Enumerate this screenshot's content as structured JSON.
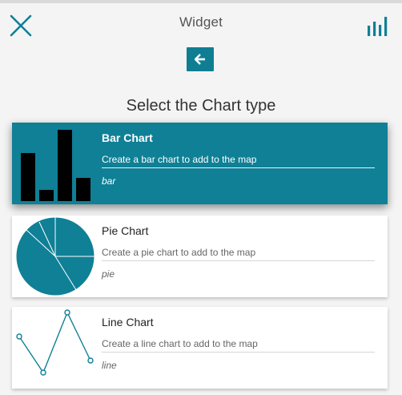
{
  "header": {
    "title": "Widget",
    "close_icon": "close-icon",
    "chart_icon": "bar-chart-icon"
  },
  "back_button": {
    "icon": "arrow-left-icon"
  },
  "section_title": "Select the Chart type",
  "chart_types": [
    {
      "name": "Bar Chart",
      "description": "Create a bar chart to add to the map",
      "tag": "bar",
      "selected": true
    },
    {
      "name": "Pie Chart",
      "description": "Create a pie chart to add to the map",
      "tag": "pie",
      "selected": false
    },
    {
      "name": "Line Chart",
      "description": "Create a line chart to add to the map",
      "tag": "line",
      "selected": false
    }
  ],
  "colors": {
    "accent": "#0f8096",
    "card_bg": "#ffffff",
    "panel_bg": "#f4f4f4"
  }
}
